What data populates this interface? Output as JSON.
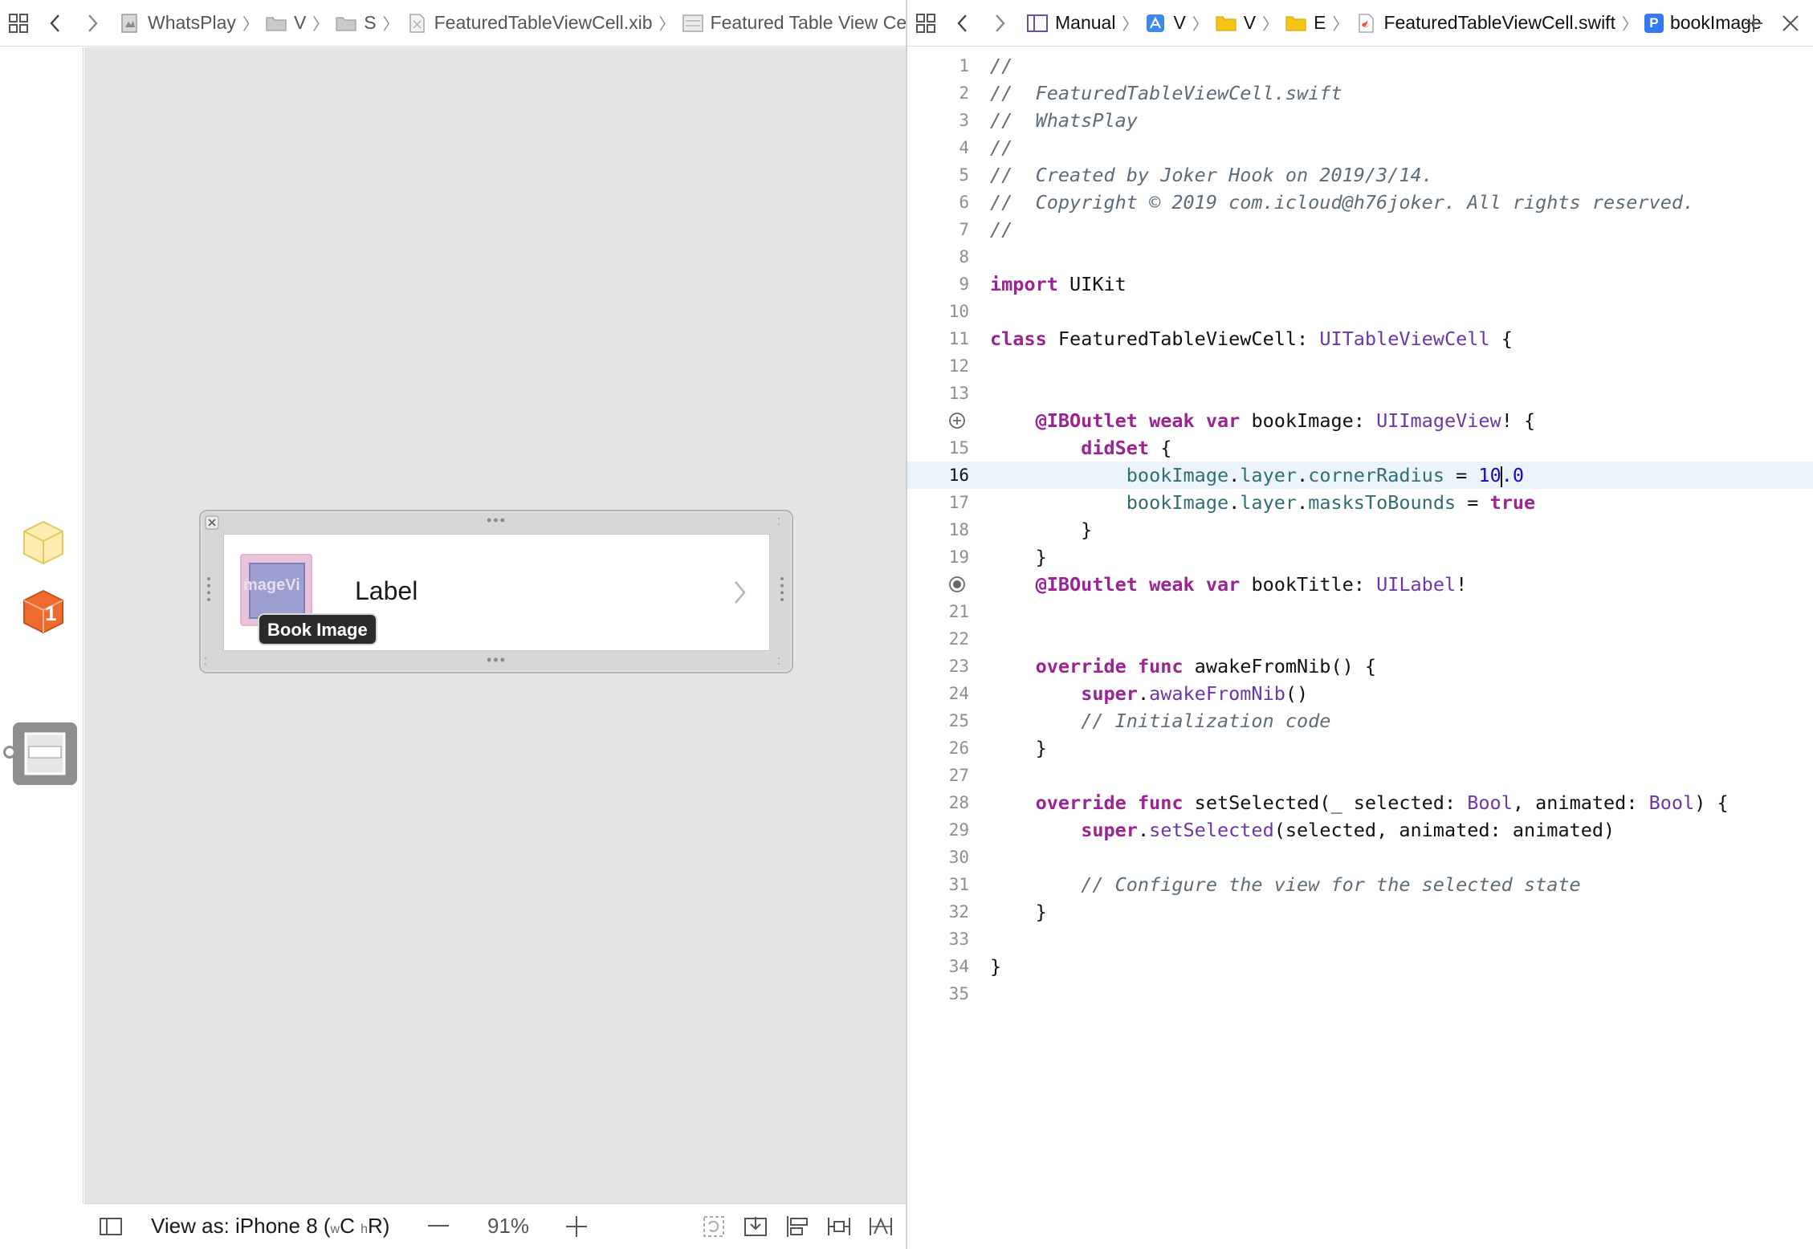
{
  "left_jumpbar": {
    "crumbs": [
      {
        "label": "WhatsPlay",
        "icon": "project-icon"
      },
      {
        "label": "V",
        "icon": "folder-icon"
      },
      {
        "label": "S",
        "icon": "folder-icon"
      },
      {
        "label": "FeaturedTableViewCell.xib",
        "icon": "xib-file-icon"
      },
      {
        "label": "Featured Table View Cell",
        "icon": "table-cell-icon"
      }
    ]
  },
  "right_jumpbar": {
    "crumbs": [
      {
        "label": "Manual",
        "icon": "manual-icon"
      },
      {
        "label": "V",
        "icon": "app-target-icon"
      },
      {
        "label": "V",
        "icon": "folder-yellow-icon"
      },
      {
        "label": "E",
        "icon": "folder-yellow-icon"
      },
      {
        "label": "FeaturedTableViewCell.swift",
        "icon": "swift-file-icon"
      },
      {
        "label": "bookImage",
        "icon": "property-icon"
      }
    ],
    "property_badge": "P"
  },
  "object_bar": {
    "placeholder_badge": "1"
  },
  "canvas": {
    "cell_label": "Label",
    "image_view_text": "mageVi",
    "tooltip": "Book Image"
  },
  "bottom_bar": {
    "view_as_prefix": "View as: iPhone 8 (",
    "size_w": "w",
    "size_c": "C",
    "size_h": "h",
    "size_r": "R)",
    "zoom": "91%"
  },
  "colors": {
    "keyword": "#9b2393",
    "type": "#6c36a9",
    "property": "#326d74",
    "number": "#1c00cf",
    "comment": "#5d6c79",
    "current_line": "#ecf4fb"
  },
  "editor": {
    "current_line": 16,
    "lines": [
      {
        "n": "1",
        "tokens": [
          {
            "t": "//",
            "c": "comment"
          }
        ]
      },
      {
        "n": "2",
        "tokens": [
          {
            "t": "//  FeaturedTableViewCell.swift",
            "c": "comment"
          }
        ]
      },
      {
        "n": "3",
        "tokens": [
          {
            "t": "//  WhatsPlay",
            "c": "comment"
          }
        ]
      },
      {
        "n": "4",
        "tokens": [
          {
            "t": "//",
            "c": "comment"
          }
        ]
      },
      {
        "n": "5",
        "tokens": [
          {
            "t": "//  Created by Joker Hook on 2019/3/14.",
            "c": "comment"
          }
        ]
      },
      {
        "n": "6",
        "tokens": [
          {
            "t": "//  Copyright © 2019 com.icloud@h76joker. All rights reserved.",
            "c": "comment"
          }
        ]
      },
      {
        "n": "7",
        "tokens": [
          {
            "t": "//",
            "c": "comment"
          }
        ]
      },
      {
        "n": "8",
        "tokens": []
      },
      {
        "n": "9",
        "tokens": [
          {
            "t": "import",
            "c": "kw"
          },
          {
            "t": " UIKit",
            "c": "plain"
          }
        ]
      },
      {
        "n": "10",
        "tokens": []
      },
      {
        "n": "11",
        "tokens": [
          {
            "t": "class",
            "c": "kw"
          },
          {
            "t": " FeaturedTableViewCell: ",
            "c": "plain"
          },
          {
            "t": "UITableViewCell",
            "c": "type"
          },
          {
            "t": " {",
            "c": "plain"
          }
        ]
      },
      {
        "n": "12",
        "tokens": []
      },
      {
        "n": "13",
        "tokens": []
      },
      {
        "n": "",
        "gutter": "outlet-connect-icon",
        "tokens": [
          {
            "t": "    ",
            "c": "plain"
          },
          {
            "t": "@IBOutlet",
            "c": "kw"
          },
          {
            "t": " ",
            "c": "plain"
          },
          {
            "t": "weak",
            "c": "kw"
          },
          {
            "t": " ",
            "c": "plain"
          },
          {
            "t": "var",
            "c": "kw"
          },
          {
            "t": " bookImage: ",
            "c": "plain"
          },
          {
            "t": "UIImageView",
            "c": "type"
          },
          {
            "t": "! {",
            "c": "plain"
          }
        ]
      },
      {
        "n": "15",
        "tokens": [
          {
            "t": "        ",
            "c": "plain"
          },
          {
            "t": "didSet",
            "c": "kw"
          },
          {
            "t": " {",
            "c": "plain"
          }
        ]
      },
      {
        "n": "16",
        "cursor_after": 4,
        "tokens": [
          {
            "t": "            ",
            "c": "plain"
          },
          {
            "t": "bookImage",
            "c": "prop"
          },
          {
            "t": ".",
            "c": "plain"
          },
          {
            "t": "layer",
            "c": "prop"
          },
          {
            "t": ".",
            "c": "plain"
          },
          {
            "t": "cornerRadius",
            "c": "prop"
          },
          {
            "t": " = ",
            "c": "plain"
          },
          {
            "t": "10",
            "c": "num"
          },
          {
            "t": ".0",
            "c": "num"
          }
        ]
      },
      {
        "n": "17",
        "tokens": [
          {
            "t": "            ",
            "c": "plain"
          },
          {
            "t": "bookImage",
            "c": "prop"
          },
          {
            "t": ".",
            "c": "plain"
          },
          {
            "t": "layer",
            "c": "prop"
          },
          {
            "t": ".",
            "c": "plain"
          },
          {
            "t": "masksToBounds",
            "c": "prop"
          },
          {
            "t": " = ",
            "c": "plain"
          },
          {
            "t": "true",
            "c": "kw"
          }
        ]
      },
      {
        "n": "18",
        "tokens": [
          {
            "t": "        }",
            "c": "plain"
          }
        ]
      },
      {
        "n": "19",
        "tokens": [
          {
            "t": "    }",
            "c": "plain"
          }
        ]
      },
      {
        "n": "",
        "gutter": "outlet-connected-icon",
        "tokens": [
          {
            "t": "    ",
            "c": "plain"
          },
          {
            "t": "@IBOutlet",
            "c": "kw"
          },
          {
            "t": " ",
            "c": "plain"
          },
          {
            "t": "weak",
            "c": "kw"
          },
          {
            "t": " ",
            "c": "plain"
          },
          {
            "t": "var",
            "c": "kw"
          },
          {
            "t": " bookTitle: ",
            "c": "plain"
          },
          {
            "t": "UILabel",
            "c": "type"
          },
          {
            "t": "!",
            "c": "plain"
          }
        ]
      },
      {
        "n": "21",
        "tokens": []
      },
      {
        "n": "22",
        "tokens": []
      },
      {
        "n": "23",
        "tokens": [
          {
            "t": "    ",
            "c": "plain"
          },
          {
            "t": "override",
            "c": "kw"
          },
          {
            "t": " ",
            "c": "plain"
          },
          {
            "t": "func",
            "c": "kw"
          },
          {
            "t": " awakeFromNib() {",
            "c": "plain"
          }
        ]
      },
      {
        "n": "24",
        "tokens": [
          {
            "t": "        ",
            "c": "plain"
          },
          {
            "t": "super",
            "c": "kw"
          },
          {
            "t": ".",
            "c": "plain"
          },
          {
            "t": "awakeFromNib",
            "c": "type"
          },
          {
            "t": "()",
            "c": "plain"
          }
        ]
      },
      {
        "n": "25",
        "tokens": [
          {
            "t": "        ",
            "c": "plain"
          },
          {
            "t": "// Initialization code",
            "c": "comment"
          }
        ]
      },
      {
        "n": "26",
        "tokens": [
          {
            "t": "    }",
            "c": "plain"
          }
        ]
      },
      {
        "n": "27",
        "tokens": []
      },
      {
        "n": "28",
        "tokens": [
          {
            "t": "    ",
            "c": "plain"
          },
          {
            "t": "override",
            "c": "kw"
          },
          {
            "t": " ",
            "c": "plain"
          },
          {
            "t": "func",
            "c": "kw"
          },
          {
            "t": " setSelected(_ selected: ",
            "c": "plain"
          },
          {
            "t": "Bool",
            "c": "type"
          },
          {
            "t": ", animated: ",
            "c": "plain"
          },
          {
            "t": "Bool",
            "c": "type"
          },
          {
            "t": ") {",
            "c": "plain"
          }
        ]
      },
      {
        "n": "29",
        "tokens": [
          {
            "t": "        ",
            "c": "plain"
          },
          {
            "t": "super",
            "c": "kw"
          },
          {
            "t": ".",
            "c": "plain"
          },
          {
            "t": "setSelected",
            "c": "type"
          },
          {
            "t": "(selected, animated: animated)",
            "c": "plain"
          }
        ]
      },
      {
        "n": "30",
        "tokens": []
      },
      {
        "n": "31",
        "tokens": [
          {
            "t": "        ",
            "c": "plain"
          },
          {
            "t": "// Configure the view for the selected state",
            "c": "comment"
          }
        ]
      },
      {
        "n": "32",
        "tokens": [
          {
            "t": "    }",
            "c": "plain"
          }
        ]
      },
      {
        "n": "33",
        "tokens": []
      },
      {
        "n": "34",
        "tokens": [
          {
            "t": "}",
            "c": "plain"
          }
        ]
      },
      {
        "n": "35",
        "tokens": []
      }
    ]
  }
}
